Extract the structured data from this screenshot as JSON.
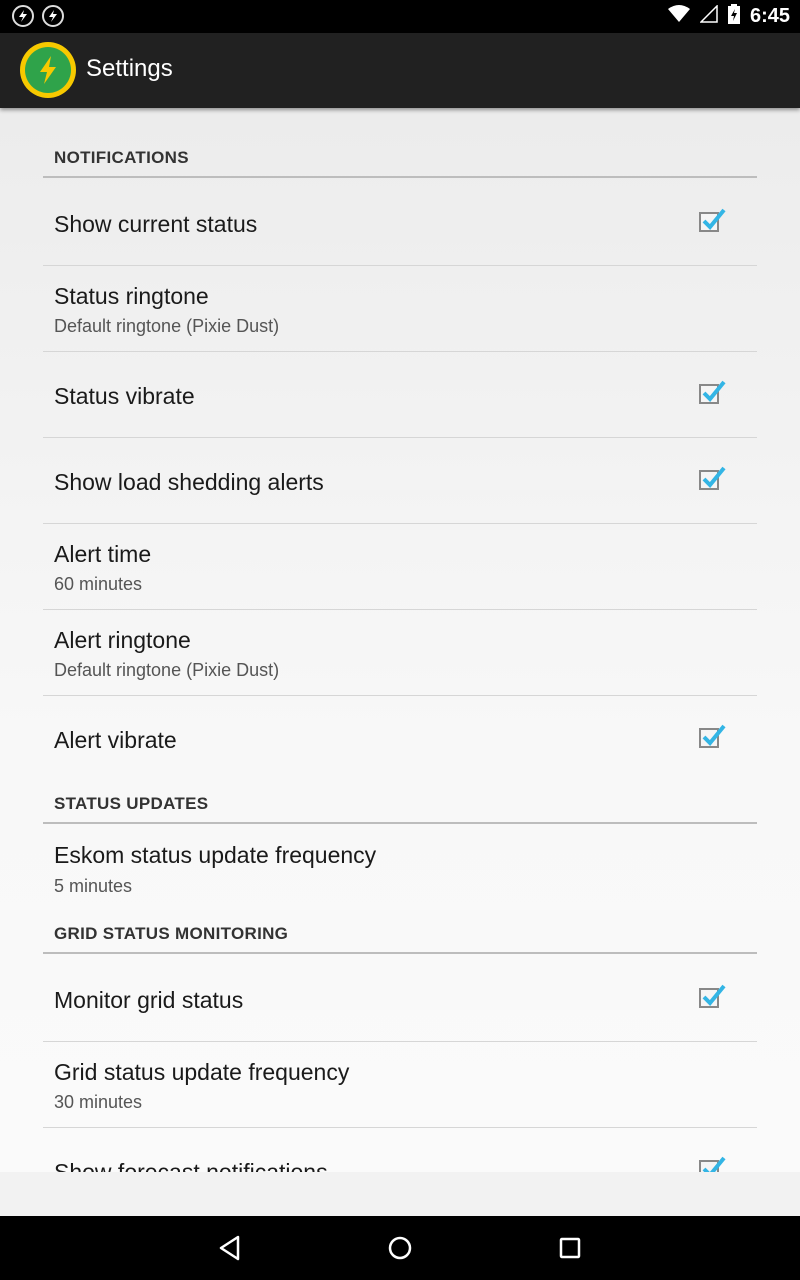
{
  "status_bar": {
    "time": "6:45",
    "left_icons": [
      "flash-notification-icon",
      "flash-notification-icon"
    ],
    "right_icons": [
      "wifi-icon",
      "signal-icon",
      "battery-charging-icon"
    ]
  },
  "action_bar": {
    "title": "Settings",
    "app_icon": "lightning-app-icon",
    "colors": {
      "background": "#212121",
      "icon_outer": "#f7c900",
      "icon_inner": "#2fa34a"
    }
  },
  "sections": {
    "notifications": "NOTIFICATIONS",
    "status_updates": "STATUS UPDATES",
    "grid_status_monitoring": "GRID STATUS MONITORING"
  },
  "items": {
    "show_current_status": {
      "title": "Show current status",
      "checked": true
    },
    "status_ringtone": {
      "title": "Status ringtone",
      "summary": "Default ringtone (Pixie Dust)"
    },
    "status_vibrate": {
      "title": "Status vibrate",
      "checked": true
    },
    "show_load_shedding_alerts": {
      "title": "Show load shedding alerts",
      "checked": true
    },
    "alert_time": {
      "title": "Alert time",
      "summary": "60 minutes"
    },
    "alert_ringtone": {
      "title": "Alert ringtone",
      "summary": "Default ringtone (Pixie Dust)"
    },
    "alert_vibrate": {
      "title": "Alert vibrate",
      "checked": true
    },
    "eskom_status_update_frequency": {
      "title": "Eskom status update frequency",
      "summary": "5 minutes"
    },
    "monitor_grid_status": {
      "title": "Monitor grid status",
      "checked": true
    },
    "grid_status_update_frequency": {
      "title": "Grid status update frequency",
      "summary": "30 minutes"
    },
    "show_forecast_notifications": {
      "title": "Show forecast notifications",
      "checked": true
    }
  },
  "accent_color": "#33b5e5",
  "nav_bar": {
    "buttons": [
      "back-icon",
      "home-icon",
      "recents-icon"
    ]
  }
}
